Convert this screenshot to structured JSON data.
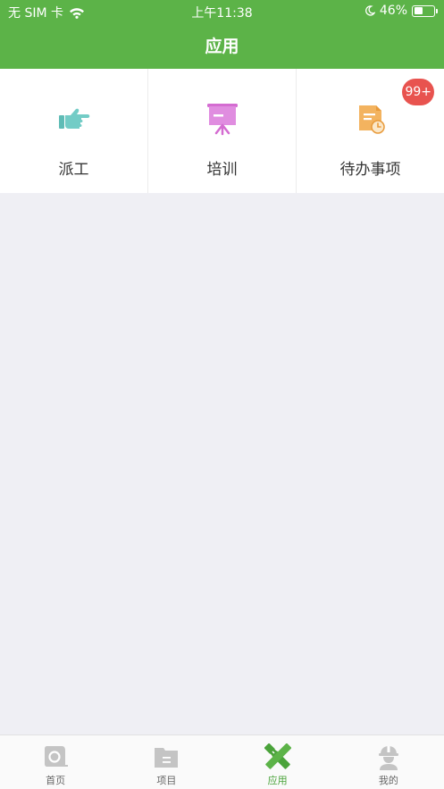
{
  "status_bar": {
    "carrier": "无 SIM 卡",
    "time": "上午11:38",
    "battery_percent": "46%",
    "battery_level": 0.46,
    "icons": [
      "wifi-icon",
      "moon-icon",
      "battery-icon"
    ]
  },
  "header": {
    "title": "应用"
  },
  "apps": [
    {
      "label": "派工",
      "icon": "pointing-hand-icon",
      "color": "#6cc6c2"
    },
    {
      "label": "培训",
      "icon": "presentation-board-icon",
      "color": "#dd7fd8"
    },
    {
      "label": "待办事项",
      "icon": "todo-document-clock-icon",
      "color": "#f3b35f",
      "badge": "99+"
    }
  ],
  "tabbar": {
    "items": [
      {
        "label": "首页",
        "icon": "home-tape-icon"
      },
      {
        "label": "项目",
        "icon": "folder-icon"
      },
      {
        "label": "应用",
        "icon": "ruler-pencil-icon",
        "active": true
      },
      {
        "label": "我的",
        "icon": "worker-helmet-icon"
      }
    ],
    "active_color": "#4aa33a",
    "inactive_color": "#c4c4c4"
  },
  "colors": {
    "brand_green": "#5cb348",
    "badge_red": "#e8534f",
    "background": "#efeff4"
  }
}
